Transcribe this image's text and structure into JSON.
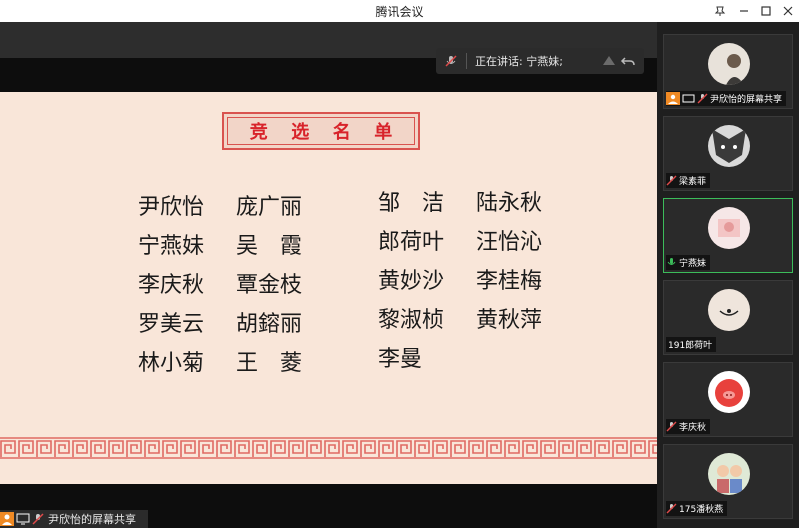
{
  "window": {
    "title": "腾讯会议"
  },
  "speaking": {
    "label": "正在讲话: 宁燕妹;"
  },
  "slide": {
    "heading": [
      "竞",
      "选",
      "名",
      "单"
    ],
    "col1": [
      "尹欣怡",
      "宁燕妹",
      "李庆秋",
      "罗美云",
      "林小菊"
    ],
    "col2": [
      "庞广丽",
      "吴　霞",
      "覃金枝",
      "胡鎔丽",
      "王　菱"
    ],
    "col3": [
      "邹　洁",
      "郎荷叶",
      "黄妙沙",
      "黎淑桢",
      "李曼"
    ],
    "col4": [
      "陆永秋",
      "汪怡沁",
      "李桂梅",
      "黄秋萍"
    ]
  },
  "share_bar": {
    "label": "尹欣怡的屏幕共享"
  },
  "participants": [
    {
      "name": "尹欣怡的屏幕共享",
      "sharing": true
    },
    {
      "name": "梁素菲"
    },
    {
      "name": "宁燕妹",
      "active": true
    },
    {
      "name": "191郎荷叶"
    },
    {
      "name": "李庆秋"
    },
    {
      "name": "175潘秋燕"
    }
  ],
  "colors": {
    "accent_red": "#d8232a",
    "active_green": "#3cbc5a",
    "share_orange": "#f08a24"
  }
}
